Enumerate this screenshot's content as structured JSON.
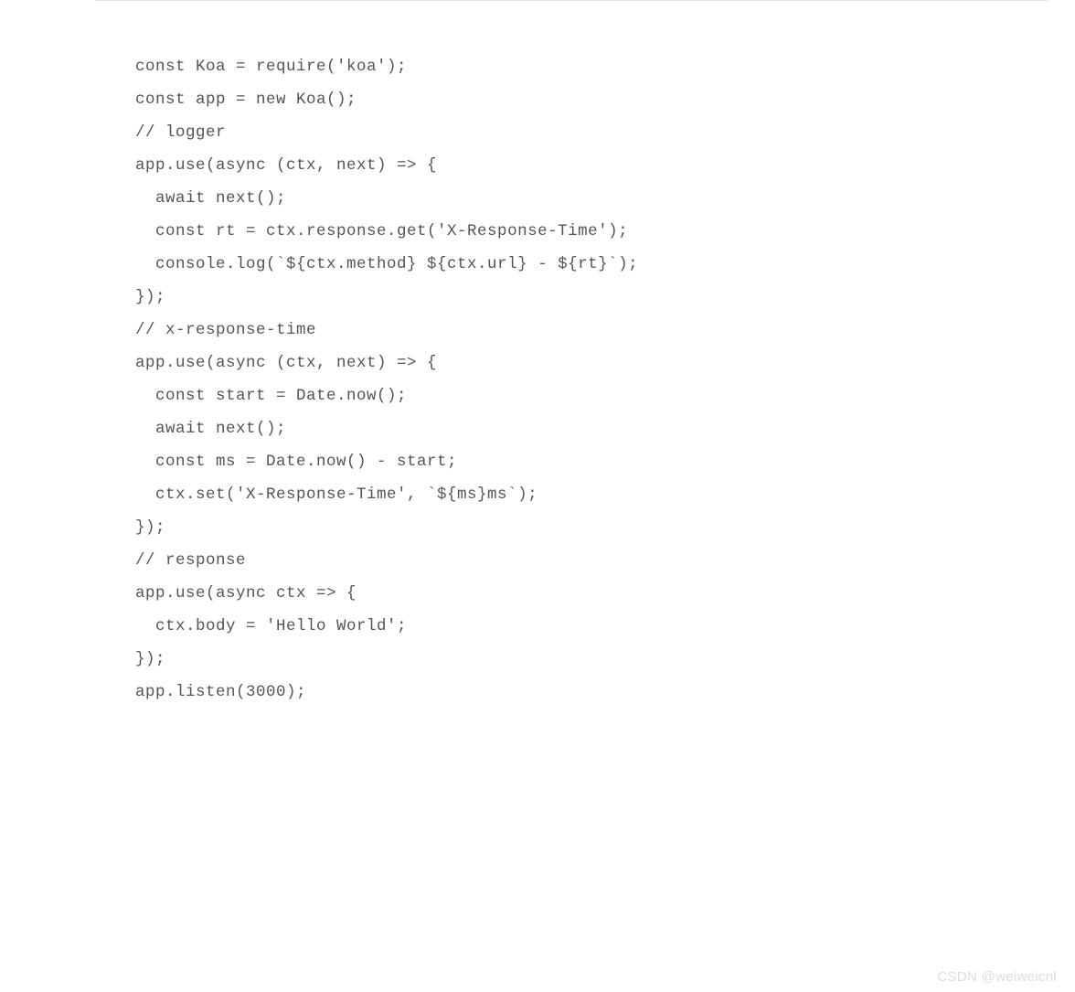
{
  "code": {
    "lines": [
      "const Koa = require('koa');",
      "const app = new Koa();",
      "",
      "// logger",
      "",
      "app.use(async (ctx, next) => {",
      "  await next();",
      "  const rt = ctx.response.get('X-Response-Time');",
      "  console.log(`${ctx.method} ${ctx.url} - ${rt}`);",
      "});",
      "",
      "// x-response-time",
      "",
      "app.use(async (ctx, next) => {",
      "  const start = Date.now();",
      "  await next();",
      "  const ms = Date.now() - start;",
      "  ctx.set('X-Response-Time', `${ms}ms`);",
      "});",
      "",
      "// response",
      "",
      "app.use(async ctx => {",
      "  ctx.body = 'Hello World';",
      "});",
      "",
      "app.listen(3000);"
    ]
  },
  "watermark": "CSDN @weiweicnl"
}
